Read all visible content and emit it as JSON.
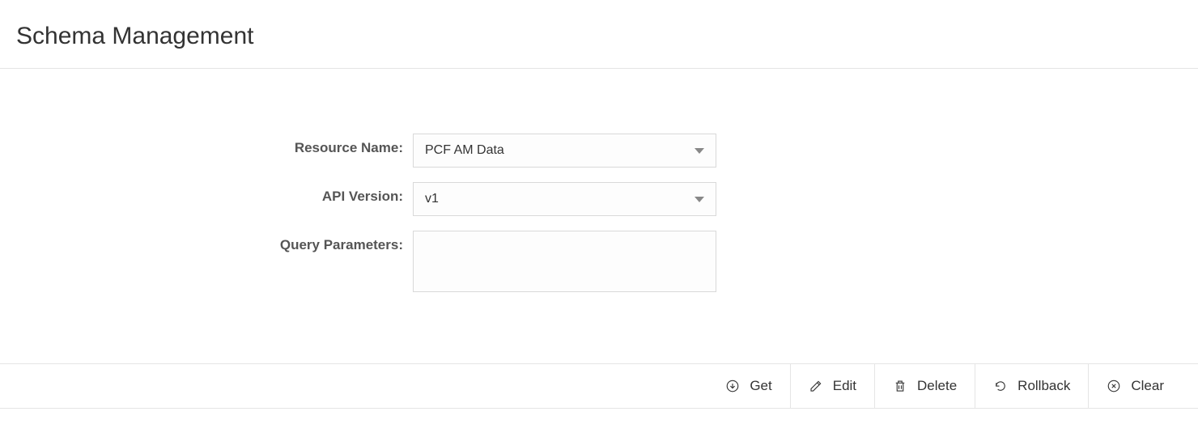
{
  "header": {
    "title": "Schema Management"
  },
  "form": {
    "resource_name": {
      "label": "Resource Name:",
      "value": "PCF AM Data"
    },
    "api_version": {
      "label": "API Version:",
      "value": "v1"
    },
    "query_parameters": {
      "label": "Query Parameters:",
      "value": ""
    }
  },
  "actions": {
    "get": "Get",
    "edit": "Edit",
    "delete": "Delete",
    "rollback": "Rollback",
    "clear": "Clear"
  }
}
